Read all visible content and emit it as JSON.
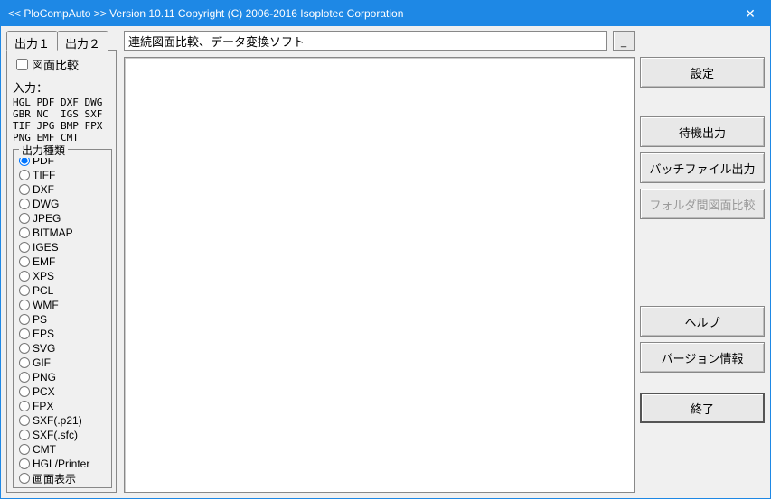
{
  "titlebar": {
    "text": "<< PloCompAuto >>  Version 10.11 Copyright (C) 2006-2016 Isoplotec Corporation",
    "close": "✕"
  },
  "tabs": {
    "tab1": "出力１",
    "tab2": "出力２"
  },
  "compare_checkbox_label": "図面比較",
  "input_label": "入力：",
  "input_formats": "HGL PDF DXF DWG\nGBR NC  IGS SXF\nTIF JPG BMP FPX\nPNG EMF CMT",
  "output_group_label": "出力種類",
  "output_types": [
    "PDF",
    "TIFF",
    "DXF",
    "DWG",
    "JPEG",
    "BITMAP",
    "IGES",
    "EMF",
    "XPS",
    "PCL",
    "WMF",
    "PS",
    "EPS",
    "SVG",
    "GIF",
    "PNG",
    "PCX",
    "FPX",
    "SXF(.p21)",
    "SXF(.sfc)",
    "CMT",
    "HGL/Printer",
    "画面表示"
  ],
  "output_selected": "PDF",
  "description": "連続図面比較、データ変換ソフト",
  "dots_label": "_",
  "buttons": {
    "settings": "設定",
    "wait_output": "待機出力",
    "batch_output": "バッチファイル出力",
    "folder_compare": "フォルダ間図面比較",
    "help": "ヘルプ",
    "version": "バージョン情報",
    "exit": "終了"
  }
}
